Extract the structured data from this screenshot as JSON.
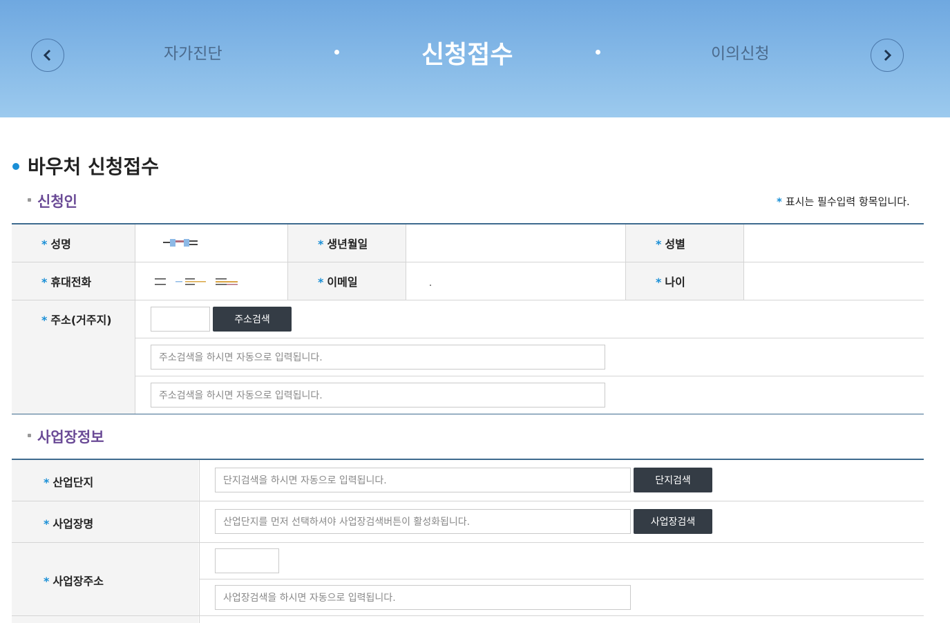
{
  "steps": {
    "prev": "자가진단",
    "current": "신청접수",
    "next": "이의신청"
  },
  "page_title": "바우처 신청접수",
  "required_mark": "*",
  "required_note": "표시는 필수입력 항목입니다.",
  "applicant": {
    "section_title": "신청인",
    "name_label": "성명",
    "birth_label": "생년월일",
    "gender_label": "성별",
    "phone_label": "휴대전화",
    "email_label": "이메일",
    "age_label": "나이",
    "address_label": "주소(거주지)",
    "address_search_button": "주소검색",
    "address1_placeholder": "주소검색을 하시면 자동으로 입력됩니다.",
    "address2_placeholder": "주소검색을 하시면 자동으로 입력됩니다."
  },
  "business": {
    "section_title": "사업장정보",
    "complex_label": "산업단지",
    "complex_placeholder": "단지검색을 하시면 자동으로 입력됩니다.",
    "complex_button": "단지검색",
    "name_label": "사업장명",
    "name_placeholder": "산업단지를 먼저 선택하셔야 사업장검색버튼이 활성화됩니다.",
    "name_button": "사업장검색",
    "address_label": "사업장주소",
    "address_placeholder": "사업장검색을 하시면 자동으로 입력됩니다."
  },
  "colors": {
    "accent": "#1a8fd6",
    "section": "#6a4a96",
    "button": "#343c45",
    "header_rule": "#3d6a8e"
  }
}
